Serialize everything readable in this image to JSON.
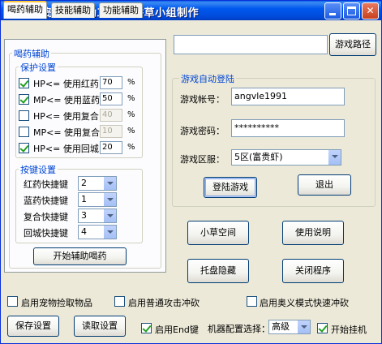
{
  "window": {
    "title": "彩虹岛小草辅助工具---香草小组制作"
  },
  "tabs": [
    {
      "label": "喝药辅助",
      "active": true
    },
    {
      "label": "技能辅助",
      "active": false
    },
    {
      "label": "功能辅助",
      "active": false
    }
  ],
  "potion": {
    "group_title": "喝药辅助",
    "protect_title": "保护设置",
    "rows": [
      {
        "label": "HP<= 使用红药",
        "checked": true,
        "value": "70",
        "enabled": true
      },
      {
        "label": "MP<= 使用蓝药",
        "checked": true,
        "value": "50",
        "enabled": true
      },
      {
        "label": "HP<= 使用复合",
        "checked": false,
        "value": "40",
        "enabled": false
      },
      {
        "label": "MP<= 使用复合",
        "checked": false,
        "value": "10",
        "enabled": false
      },
      {
        "label": "HP<= 使用回城",
        "checked": true,
        "value": "20",
        "enabled": true
      }
    ],
    "percent": "%",
    "hotkey_title": "按键设置",
    "hotkeys": [
      {
        "label": "红药快捷键",
        "value": "2"
      },
      {
        "label": "蓝药快捷键",
        "value": "1"
      },
      {
        "label": "复合快捷键",
        "value": "3"
      },
      {
        "label": "回城快捷键",
        "value": "4"
      }
    ],
    "start_button": "开始辅助喝药"
  },
  "game_path": {
    "value": "",
    "button": "游戏路径"
  },
  "login": {
    "group_title": "游戏自动登陆",
    "account_label": "游戏帐号：",
    "account_value": "angvle1991",
    "password_label": "游戏密码：",
    "password_value": "**********",
    "server_label": "游戏区服：",
    "server_value": "5区(富贵虾)",
    "login_button": "登陆游戏",
    "exit_button": "退出"
  },
  "actions": {
    "grass_space": "小草空间",
    "usage": "使用说明",
    "tray_hide": "托盘隐藏",
    "close_app": "关闭程序"
  },
  "options": {
    "pet_pickup": {
      "label": "启用宠物捡取物品",
      "checked": false
    },
    "normal_attack": {
      "label": "启用普通攻击冲砍",
      "checked": false
    },
    "aoyi_mode": {
      "label": "启用奥义模式快速冲砍",
      "checked": false
    }
  },
  "bottom": {
    "save_settings": "保存设置",
    "load_settings": "读取设置",
    "end_key": {
      "label": "启用End键",
      "checked": true
    },
    "machine_config_label": "机器配置选择：",
    "machine_config_value": "高级",
    "start_hang": {
      "label": "开始挂机",
      "checked": true
    }
  }
}
